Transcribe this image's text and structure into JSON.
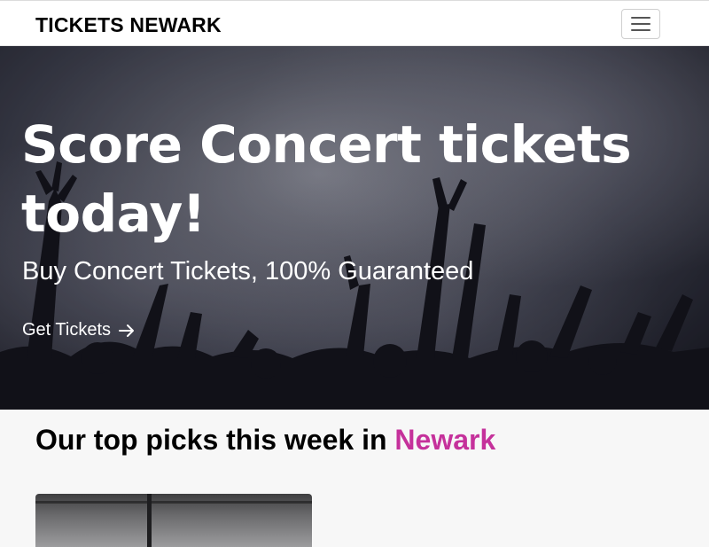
{
  "navbar": {
    "brand": "TICKETS NEWARK",
    "menu_icon": "hamburger-menu-icon"
  },
  "hero": {
    "title": "Score Concert tickets today!",
    "subtitle": "Buy Concert Tickets, 100% Guaranteed",
    "cta_label": "Get Tickets",
    "cta_icon": "arrow-right-icon",
    "background_image": "concert-crowd-hands-raised"
  },
  "picks": {
    "heading_prefix": "Our top picks this week in ",
    "city": "Newark",
    "city_color": "#c5319b",
    "first_card_image": "concert-stage-photo"
  },
  "colors": {
    "navbar_bg": "#ffffff",
    "page_bg": "#f7f7f7",
    "accent": "#c5319b",
    "hero_text": "#ffffff"
  }
}
